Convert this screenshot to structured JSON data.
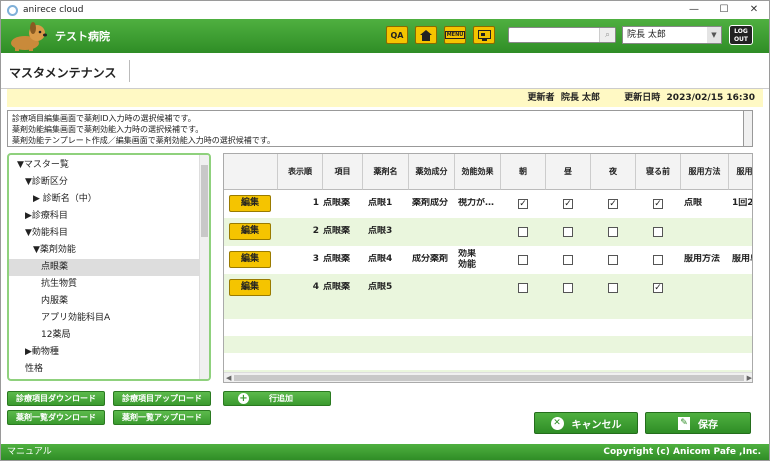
{
  "window": {
    "title": "anirece cloud",
    "controls": [
      "—",
      "☐",
      "✕"
    ]
  },
  "header": {
    "clinic_name": "テスト病院",
    "qa_label": "QA",
    "menu_label": "MENU",
    "search_value": "",
    "user_selected": "院長 太郎",
    "logout_line1": "LOG",
    "logout_line2": "OUT"
  },
  "page": {
    "title": "マスタメンテナンス",
    "updater_label": "更新者",
    "updater": "院長 太郎",
    "updated_label": "更新日時",
    "updated_at": "2023/02/15 16:30"
  },
  "notes": [
    "診療項目編集画面で薬剤ID入力時の選択候補です。",
    "薬剤効能編集画面で薬剤効能入力時の選択候補です。",
    "薬剤効能テンプレート作成／編集画面で薬剤効能入力時の選択候補です。"
  ],
  "tree": [
    {
      "label": "▼マスター覧",
      "indent": 0,
      "selected": false
    },
    {
      "label": "▼診断区分",
      "indent": 1,
      "selected": false
    },
    {
      "label": "▶ 診断名（中）",
      "indent": 2,
      "selected": false
    },
    {
      "label": "▶診療科目",
      "indent": 1,
      "selected": false
    },
    {
      "label": "▼効能科目",
      "indent": 1,
      "selected": false
    },
    {
      "label": "▼薬剤効能",
      "indent": 2,
      "selected": false
    },
    {
      "label": "点眼薬",
      "indent": 3,
      "selected": true
    },
    {
      "label": "抗生物質",
      "indent": 3,
      "selected": false
    },
    {
      "label": "内服薬",
      "indent": 3,
      "selected": false
    },
    {
      "label": "アプリ効能科目A",
      "indent": 3,
      "selected": false
    },
    {
      "label": "12薬局",
      "indent": 3,
      "selected": false
    },
    {
      "label": "▶動物種",
      "indent": 1,
      "selected": false
    },
    {
      "label": "性格",
      "indent": 1,
      "selected": false
    }
  ],
  "grid": {
    "headers": [
      "",
      "表示順",
      "項目",
      "薬剤名",
      "薬効成分",
      "効能効果",
      "朝",
      "昼",
      "夜",
      "寝る前",
      "服用方法",
      "服用単"
    ],
    "edit_label": "編集",
    "rows": [
      {
        "order": "1",
        "item": "点眼薬",
        "name": "点眼1",
        "component": "薬剤成分",
        "effect": "視力が…",
        "morning": true,
        "noon": true,
        "night": true,
        "bedtime": true,
        "method": "点眼",
        "unit": "1回2"
      },
      {
        "order": "2",
        "item": "点眼薬",
        "name": "点眼3",
        "component": "",
        "effect": "",
        "morning": false,
        "noon": false,
        "night": false,
        "bedtime": false,
        "method": "",
        "unit": ""
      },
      {
        "order": "3",
        "item": "点眼薬",
        "name": "点眼4",
        "component": "成分薬剤",
        "effect": "効果\n効能",
        "morning": false,
        "noon": false,
        "night": false,
        "bedtime": false,
        "method": "服用方法",
        "unit": "服用単"
      },
      {
        "order": "4",
        "item": "点眼薬",
        "name": "点眼5",
        "component": "",
        "effect": "",
        "morning": false,
        "noon": false,
        "night": false,
        "bedtime": true,
        "method": "",
        "unit": ""
      }
    ]
  },
  "buttons": {
    "dl_items": "診療項目ダウンロード",
    "ul_items": "診療項目アップロード",
    "dl_drugs": "薬剤一覧ダウンロード",
    "ul_drugs": "薬剤一覧アップロード",
    "add_row": "行追加",
    "cancel": "キャンセル",
    "save": "保存"
  },
  "footer": {
    "manual": "マニュアル",
    "copyright": "Copyright (c) Anicom Pafe ,Inc."
  },
  "colors": {
    "brand_green": "#3a9a2e",
    "accent_yellow": "#f5c400",
    "row_alt": "#eaf6dd",
    "info_bar": "#fff9c4"
  }
}
